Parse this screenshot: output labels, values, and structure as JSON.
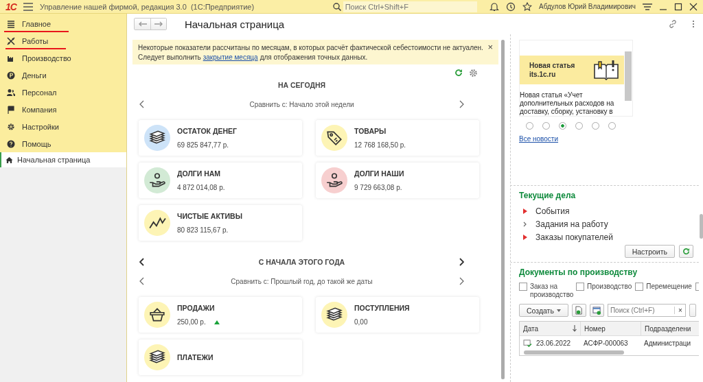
{
  "titlebar": {
    "logo": "1С",
    "title": "Управление нашей фирмой, редакция 3.0  (1С:Предприятие)",
    "search": {
      "placeholder": "Поиск Ctrl+Shift+F"
    },
    "user": "Абдулов Юрий Владимирович"
  },
  "sidebar": {
    "items": [
      {
        "label": "Главное",
        "underlined": true
      },
      {
        "label": "Работы",
        "underlined": true
      },
      {
        "label": "Производство",
        "underlined": false
      },
      {
        "label": "Деньги",
        "underlined": false
      },
      {
        "label": "Персонал",
        "underlined": false
      },
      {
        "label": "Компания",
        "underlined": false
      },
      {
        "label": "Настройки",
        "underlined": false
      },
      {
        "label": "Помощь",
        "underlined": false
      }
    ],
    "open_pages": [
      {
        "label": "Начальная страница",
        "selected": true
      }
    ]
  },
  "page": {
    "title": "Начальная страница",
    "notice": {
      "text": "Некоторые показатели рассчитаны по месяцам, в которых расчёт фактической себестоимости не актуален.",
      "text2_before": "Следует выполнить",
      "link": "закрытие месяца",
      "text2_after": "для отображения точных данных.",
      "close": "×"
    },
    "sections": [
      {
        "title": "НА СЕГОДНЯ",
        "title_nav": false,
        "compare": "Сравнить с: Начало этой недели",
        "cards": [
          {
            "kind": "money",
            "color": "#cde3f8",
            "title": "ОСТАТОК ДЕНЕГ",
            "value": "69 825 847,77 р."
          },
          {
            "kind": "tag",
            "color": "#fdf4b5",
            "title": "ТОВАРЫ",
            "value": "12 768 168,50 р."
          },
          {
            "kind": "hand",
            "color": "#d2ead5",
            "title": "ДОЛГИ НАМ",
            "value": "4 872 014,08 р."
          },
          {
            "kind": "hand",
            "color": "#f7cfcf",
            "title": "ДОЛГИ НАШИ",
            "value": "9 729 663,08 р."
          },
          {
            "kind": "chart",
            "color": "#fdf4b5",
            "title": "ЧИСТЫЕ АКТИВЫ",
            "value": "80 823 115,67 р."
          }
        ]
      },
      {
        "title": "С НАЧАЛА ЭТОГО ГОДА",
        "title_nav": true,
        "compare": "Сравнить с: Прошлый год, до такой же даты",
        "cards": [
          {
            "kind": "basket",
            "color": "#fdf4b5",
            "title": "ПРОДАЖИ",
            "value": "250,00 р.",
            "trend_up": true
          },
          {
            "kind": "money",
            "color": "#fdf4b5",
            "title": "ПОСТУПЛЕНИЯ",
            "value": "0,00"
          },
          {
            "kind": "money",
            "color": "#fdf4b5",
            "title": "ПЛАТЕЖИ"
          }
        ]
      }
    ]
  },
  "news": {
    "banner_title": "Новая статья\nits.1c.ru",
    "text": "Новая статья «Учет дополнительных расходов на доставку, сборку, установку в",
    "dots": [
      {
        "selected": false
      },
      {
        "selected": false
      },
      {
        "selected": true
      },
      {
        "selected": false
      },
      {
        "selected": false
      },
      {
        "selected": false
      }
    ],
    "all_link": "Все новости"
  },
  "tasks": {
    "title": "Текущие дела",
    "items": [
      {
        "label": "События",
        "flagged": true
      },
      {
        "label": "Задания на работу",
        "flagged": false
      },
      {
        "label": "Заказы покупателей",
        "flagged": true
      }
    ],
    "configure": "Настроить"
  },
  "documents": {
    "title": "Документы по производству",
    "filters": [
      {
        "label": "Заказ на производство",
        "checked": false
      },
      {
        "label": "Производство",
        "checked": false
      },
      {
        "label": "Перемещение",
        "checked": false
      },
      {
        "checked": false
      }
    ],
    "create": "Создать",
    "search": {
      "placeholder": "Поиск (Ctrl+F)"
    },
    "clear": "×",
    "columns": [
      "Дата",
      "Номер",
      "Подразделени"
    ],
    "rows": [
      {
        "cells": [
          "23.06.2022",
          "АСФР-000063",
          "Администраци"
        ]
      }
    ]
  }
}
